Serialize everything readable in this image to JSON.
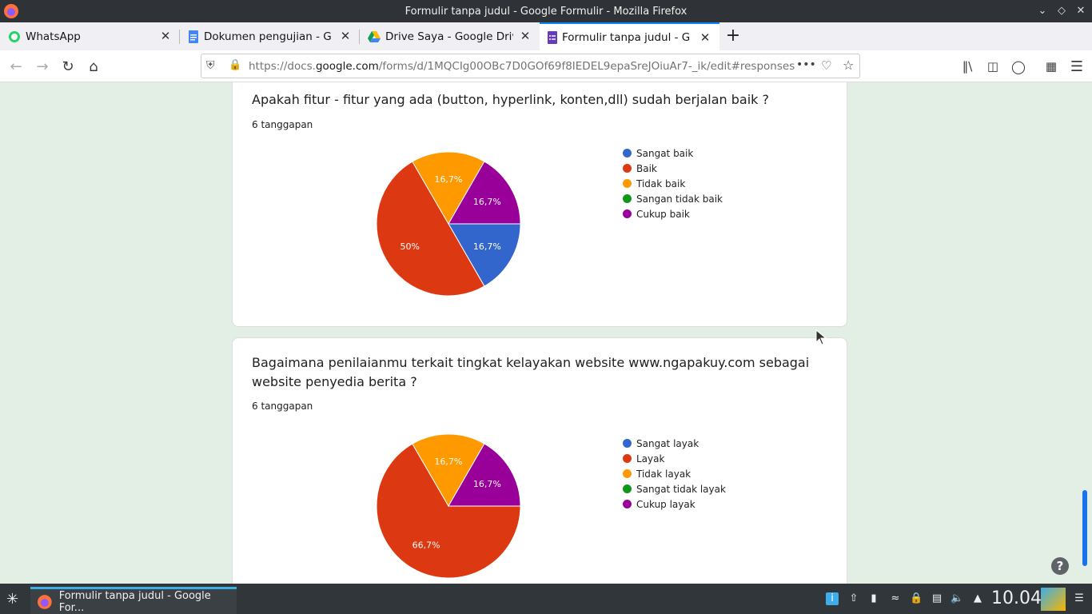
{
  "window": {
    "title": "Formulir tanpa judul - Google Formulir - Mozilla Firefox"
  },
  "tabs": [
    {
      "label": "WhatsApp",
      "icon": "whatsapp-icon",
      "color": "#25d366"
    },
    {
      "label": "Dokumen pengujian - Goo",
      "icon": "google-docs-icon",
      "color": "#4285f4"
    },
    {
      "label": "Drive Saya - Google Drive",
      "icon": "google-drive-icon",
      "color": "#fbbc04"
    },
    {
      "label": "Formulir tanpa judul - Goo",
      "icon": "google-forms-icon",
      "color": "#673ab7",
      "active": true
    }
  ],
  "address": {
    "prefix": "https://docs.",
    "domain": "google.com",
    "suffix": "/forms/d/1MQCIg00OBc7D0GOf69f8IEDEL9epaSreJOiuAr7-_ik/edit#responses"
  },
  "questions": [
    {
      "title": "Apakah fitur - fitur yang ada (button, hyperlink, konten,dll) sudah berjalan baik ?",
      "count": "6 tanggapan",
      "legend": [
        "Sangat baik",
        "Baik",
        "Tidak baik",
        "Sangan tidak baik",
        "Cukup baik"
      ]
    },
    {
      "title_line1": "Bagaimana penilaianmu terkait tingkat kelayakan website www.ngapakuy.com sebagai",
      "title_line2": "website penyedia berita ?",
      "count": "6 tanggapan",
      "legend": [
        "Sangat layak",
        "Layak",
        "Tidak layak",
        "Sangat tidak layak",
        "Cukup layak"
      ]
    }
  ],
  "colors": [
    "#3366cc",
    "#dc3912",
    "#ff9900",
    "#109618",
    "#990099"
  ],
  "chart_data": [
    {
      "type": "pie",
      "categories": [
        "Sangat baik",
        "Baik",
        "Tidak baik",
        "Sangan tidak baik",
        "Cukup baik"
      ],
      "values": [
        16.7,
        50,
        16.7,
        0,
        16.7
      ],
      "labels": [
        "16,7%",
        "50%",
        "16,7%",
        "",
        "16,7%"
      ],
      "legend_position": "right"
    },
    {
      "type": "pie",
      "categories": [
        "Sangat layak",
        "Layak",
        "Tidak layak",
        "Sangat tidak layak",
        "Cukup layak"
      ],
      "values": [
        0,
        66.7,
        16.7,
        0,
        16.7
      ],
      "labels": [
        "",
        "66,7%",
        "16,7%",
        "",
        "16,7%"
      ],
      "legend_position": "right"
    }
  ],
  "taskbar": {
    "task_label": "Formulir tanpa judul - Google For...",
    "clock": "10.04"
  }
}
